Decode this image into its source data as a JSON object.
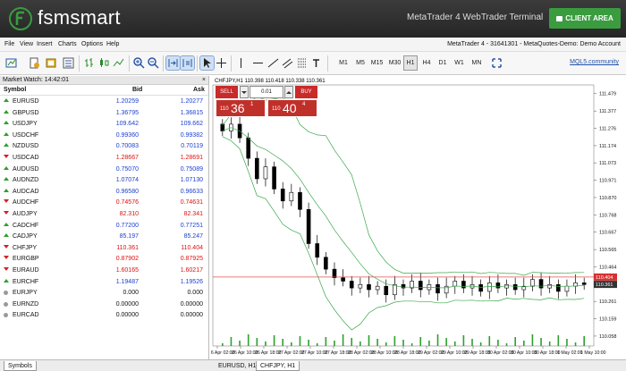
{
  "header": {
    "brand": "fsmsmart",
    "terminal_title": "MetaTrader 4 WebTrader Terminal",
    "client_button": "CLIENT AREA",
    "colors": {
      "brand_bg": "#2d2d2d",
      "accent_green": "#3a9c3f"
    }
  },
  "menu": {
    "items": [
      "File",
      "View",
      "Insert",
      "Charts",
      "Options",
      "Help"
    ],
    "account": "MetaTrader 4 - 31641301 - MetaQuotes-Demo: Demo Account"
  },
  "toolbar": {
    "timeframes": [
      "M1",
      "M5",
      "M15",
      "M30",
      "H1",
      "H4",
      "D1",
      "W1",
      "MN"
    ],
    "active_timeframe": "H1",
    "community_link": "MQL5.community"
  },
  "market_watch": {
    "title": "Market Watch: 14:42:01",
    "close": "×",
    "col_symbol": "Symbol",
    "col_bid": "Bid",
    "col_ask": "Ask",
    "rows": [
      {
        "symbol": "EURUSD",
        "bid": "1.20259",
        "ask": "1.20277",
        "dir": "up"
      },
      {
        "symbol": "GBPUSD",
        "bid": "1.36795",
        "ask": "1.36815",
        "dir": "up"
      },
      {
        "symbol": "USDJPY",
        "bid": "109.642",
        "ask": "109.662",
        "dir": "up"
      },
      {
        "symbol": "USDCHF",
        "bid": "0.99360",
        "ask": "0.99382",
        "dir": "up"
      },
      {
        "symbol": "NZDUSD",
        "bid": "0.70083",
        "ask": "0.70119",
        "dir": "up"
      },
      {
        "symbol": "USDCAD",
        "bid": "1.28667",
        "ask": "1.28691",
        "dir": "down"
      },
      {
        "symbol": "AUDUSD",
        "bid": "0.75070",
        "ask": "0.75089",
        "dir": "up"
      },
      {
        "symbol": "AUDNZD",
        "bid": "1.07074",
        "ask": "1.07130",
        "dir": "up"
      },
      {
        "symbol": "AUDCAD",
        "bid": "0.96580",
        "ask": "0.96633",
        "dir": "up"
      },
      {
        "symbol": "AUDCHF",
        "bid": "0.74576",
        "ask": "0.74631",
        "dir": "down"
      },
      {
        "symbol": "AUDJPY",
        "bid": "82.310",
        "ask": "82.341",
        "dir": "down"
      },
      {
        "symbol": "CADCHF",
        "bid": "0.77200",
        "ask": "0.77251",
        "dir": "up"
      },
      {
        "symbol": "CADJPY",
        "bid": "85.197",
        "ask": "85.247",
        "dir": "up"
      },
      {
        "symbol": "CHFJPY",
        "bid": "110.361",
        "ask": "110.404",
        "dir": "down"
      },
      {
        "symbol": "EURGBP",
        "bid": "0.87902",
        "ask": "0.87925",
        "dir": "down"
      },
      {
        "symbol": "EURAUD",
        "bid": "1.60165",
        "ask": "1.60217",
        "dir": "down"
      },
      {
        "symbol": "EURCHF",
        "bid": "1.19487",
        "ask": "1.19526",
        "dir": "up"
      },
      {
        "symbol": "EURJPY",
        "bid": "0.000",
        "ask": "0.000",
        "dir": "none"
      },
      {
        "symbol": "EURNZD",
        "bid": "0.00000",
        "ask": "0.00000",
        "dir": "none"
      },
      {
        "symbol": "EURCAD",
        "bid": "0.00000",
        "ask": "0.00000",
        "dir": "none"
      }
    ]
  },
  "chart": {
    "header": "CHFJPY,H1  110.398 110.418 110.338 110.361",
    "trade": {
      "sell": "SELL",
      "buy": "BUY",
      "lot": "0.01",
      "bid_small": "110",
      "bid_big": "36",
      "bid_sup": "1",
      "ask_small": "110",
      "ask_big": "40",
      "ask_sup": "4"
    },
    "price_labels": [
      "111.479",
      "111.377",
      "111.276",
      "111.174",
      "111.073",
      "110.971",
      "110.870",
      "110.768",
      "110.667",
      "110.565",
      "110.464",
      "110.362",
      "110.261",
      "110.159",
      "110.058"
    ],
    "current_ask": "110.404",
    "current_bid": "110.361",
    "time_labels": [
      "26 Apr 02:00",
      "26 Apr 10:00",
      "26 Apr 18:00",
      "27 Apr 02:00",
      "27 Apr 10:00",
      "27 Apr 18:00",
      "28 Apr 02:00",
      "28 Apr 10:00",
      "28 Apr 18:00",
      "29 Apr 02:00",
      "29 Apr 10:00",
      "29 Apr 18:00",
      "30 Apr 02:00",
      "30 Apr 10:00",
      "30 Apr 18:00",
      "1 May 02:00",
      "1 May 10:00"
    ]
  },
  "chart_data": {
    "type": "candlestick",
    "symbol": "CHFJPY",
    "timeframe": "H1",
    "ylim": [
      110.0,
      111.53
    ],
    "indicator": "bollinger-bands",
    "closes": [
      111.26,
      111.3,
      111.22,
      111.1,
      110.98,
      111.05,
      110.92,
      110.85,
      110.9,
      110.8,
      110.6,
      110.52,
      110.45,
      110.4,
      110.38,
      110.34,
      110.36,
      110.33,
      110.35,
      110.3,
      110.36,
      110.34,
      110.38,
      110.33,
      110.36,
      110.31,
      110.35,
      110.38,
      110.34,
      110.36,
      110.32,
      110.37,
      110.34,
      110.36,
      110.33,
      110.35,
      110.39,
      110.34,
      110.36,
      110.32,
      110.35,
      110.37,
      110.36
    ]
  },
  "tabs": {
    "symbols": "Symbols",
    "chart_tabs": [
      "EURUSD, H1",
      "CHFJPY, H1"
    ]
  }
}
